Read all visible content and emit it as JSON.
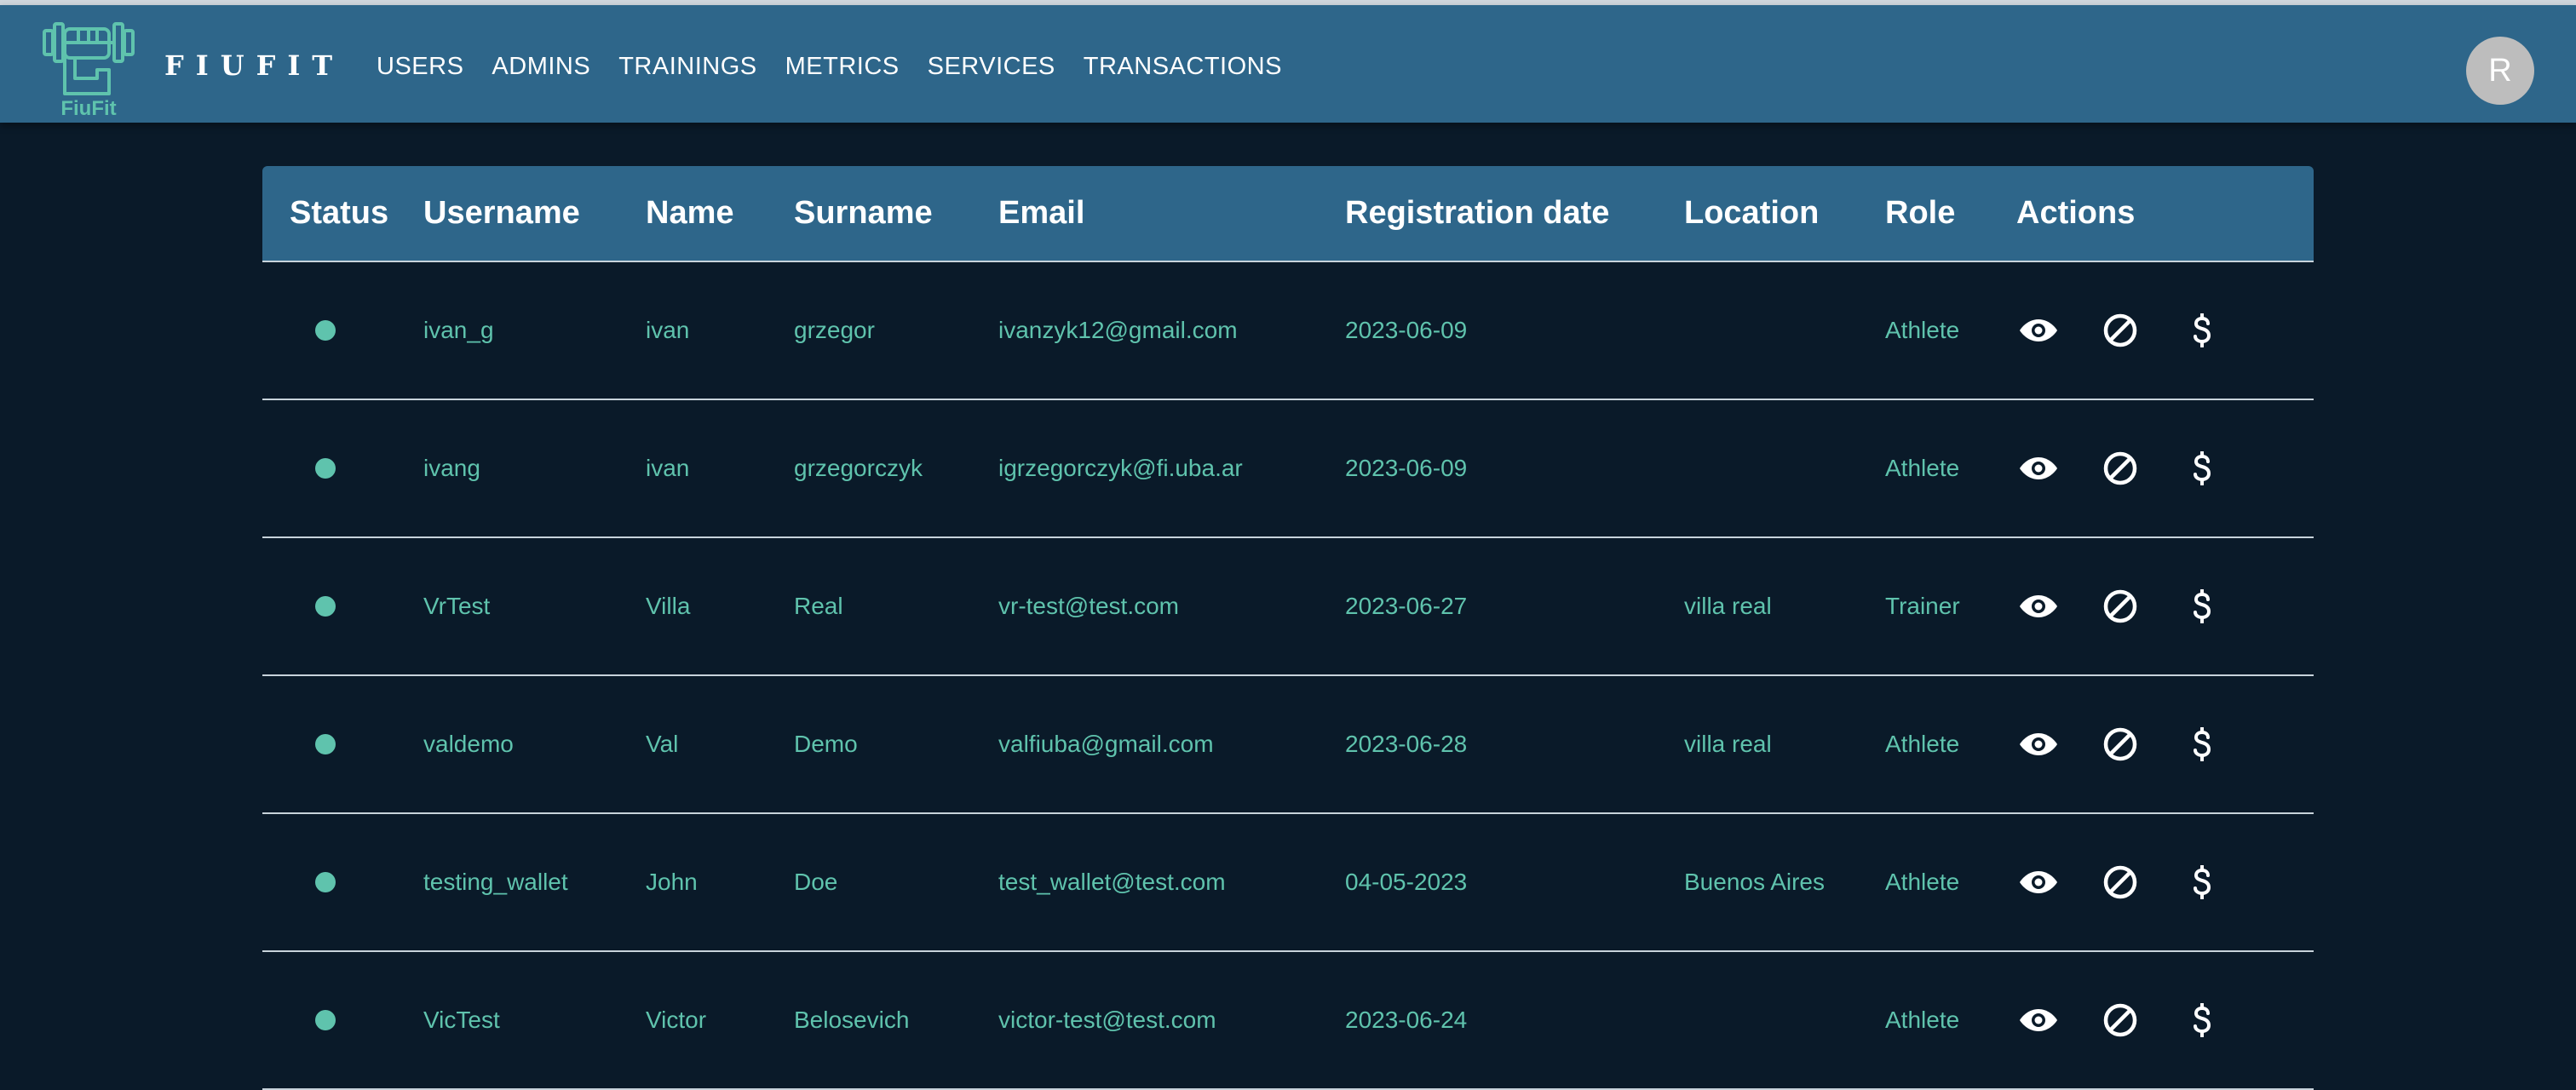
{
  "app": {
    "logo_text": "FiuFit",
    "brand": "FIUFIT",
    "avatar_initial": "R"
  },
  "nav": [
    {
      "label": "USERS"
    },
    {
      "label": "ADMINS"
    },
    {
      "label": "TRAININGS"
    },
    {
      "label": "METRICS"
    },
    {
      "label": "SERVICES"
    },
    {
      "label": "TRANSACTIONS"
    }
  ],
  "table": {
    "headers": [
      "Status",
      "Username",
      "Name",
      "Surname",
      "Email",
      "Registration date",
      "Location",
      "Role",
      "Actions"
    ],
    "rows": [
      {
        "status": "active",
        "username": "ivan_g",
        "name": "ivan",
        "surname": "grzegor",
        "email": "ivanzyk12@gmail.com",
        "registration_date": "2023-06-09",
        "location": "",
        "role": "Athlete"
      },
      {
        "status": "active",
        "username": "ivang",
        "name": "ivan",
        "surname": "grzegorczyk",
        "email": "igrzegorczyk@fi.uba.ar",
        "registration_date": "2023-06-09",
        "location": "",
        "role": "Athlete"
      },
      {
        "status": "active",
        "username": "VrTest",
        "name": "Villa",
        "surname": "Real",
        "email": "vr-test@test.com",
        "registration_date": "2023-06-27",
        "location": "villa real",
        "role": "Trainer"
      },
      {
        "status": "active",
        "username": "valdemo",
        "name": "Val",
        "surname": "Demo",
        "email": "valfiuba@gmail.com",
        "registration_date": "2023-06-28",
        "location": "villa real",
        "role": "Athlete"
      },
      {
        "status": "active",
        "username": "testing_wallet",
        "name": "John",
        "surname": "Doe",
        "email": "test_wallet@test.com",
        "registration_date": "04-05-2023",
        "location": "Buenos Aires",
        "role": "Athlete"
      },
      {
        "status": "active",
        "username": "VicTest",
        "name": "Victor",
        "surname": "Belosevich",
        "email": "victor-test@test.com",
        "registration_date": "2023-06-24",
        "location": "",
        "role": "Athlete"
      }
    ],
    "row_actions": [
      "eye-icon",
      "block-icon",
      "dollar-icon"
    ]
  },
  "colors": {
    "navbar": "#2e668a",
    "background": "#0a1a29",
    "accent": "#5fc3ad",
    "divider": "#c8d3db"
  }
}
